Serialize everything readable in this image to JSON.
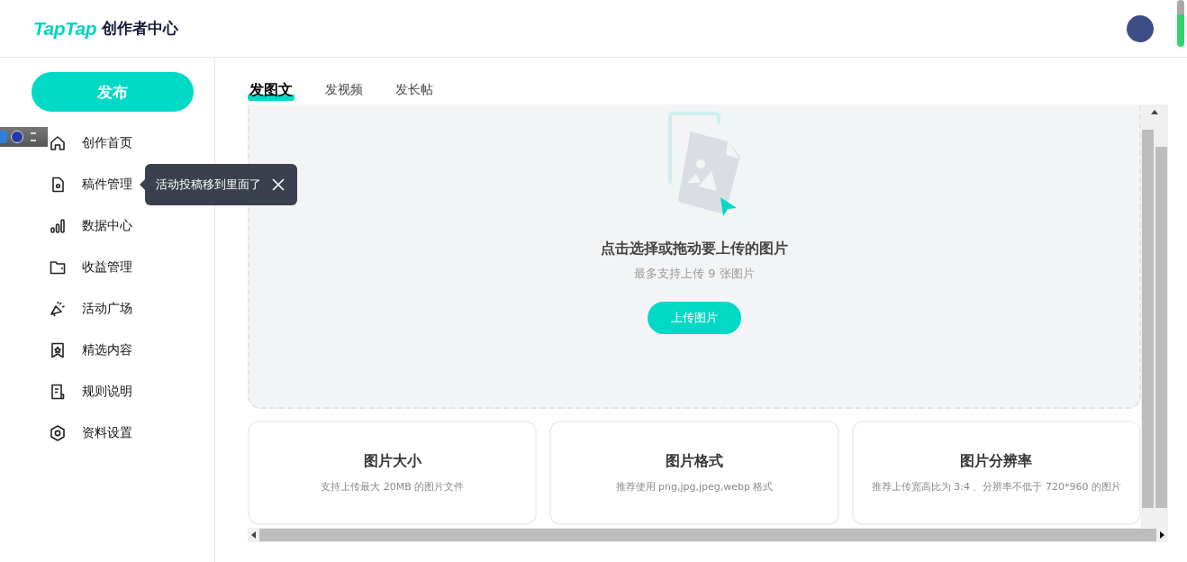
{
  "header": {
    "brand": "TapTap",
    "title": "创作者中心"
  },
  "sidebar": {
    "publish_button": "发布",
    "items": [
      {
        "label": "创作首页",
        "kind": "home"
      },
      {
        "label": "稿件管理",
        "kind": "draft"
      },
      {
        "label": "数据中心",
        "kind": "data"
      },
      {
        "label": "收益管理",
        "kind": "wallet"
      },
      {
        "label": "活动广场",
        "kind": "megaphone"
      },
      {
        "label": "精选内容",
        "kind": "badge"
      },
      {
        "label": "规则说明",
        "kind": "rules"
      },
      {
        "label": "资料设置",
        "kind": "settings"
      }
    ]
  },
  "tooltip": {
    "text": "活动投稿移到里面了"
  },
  "tabs": [
    {
      "label": "发图文",
      "selected": true
    },
    {
      "label": "发视频",
      "selected": false
    },
    {
      "label": "发长帖",
      "selected": false
    }
  ],
  "upload": {
    "title": "点击选择或拖动要上传的图片",
    "hint": "最多支持上传 9 张图片",
    "button": "上传图片"
  },
  "info_cards": [
    {
      "title": "图片大小",
      "description": "支持上传最大 20MB 的图片文件"
    },
    {
      "title": "图片格式",
      "description": "推荐使用 png,jpg,jpeg,webp 格式"
    },
    {
      "title": "图片分辨率",
      "description": "推荐上传宽高比为 3:4 、分辨率不低于 720*960 的图片"
    }
  ]
}
